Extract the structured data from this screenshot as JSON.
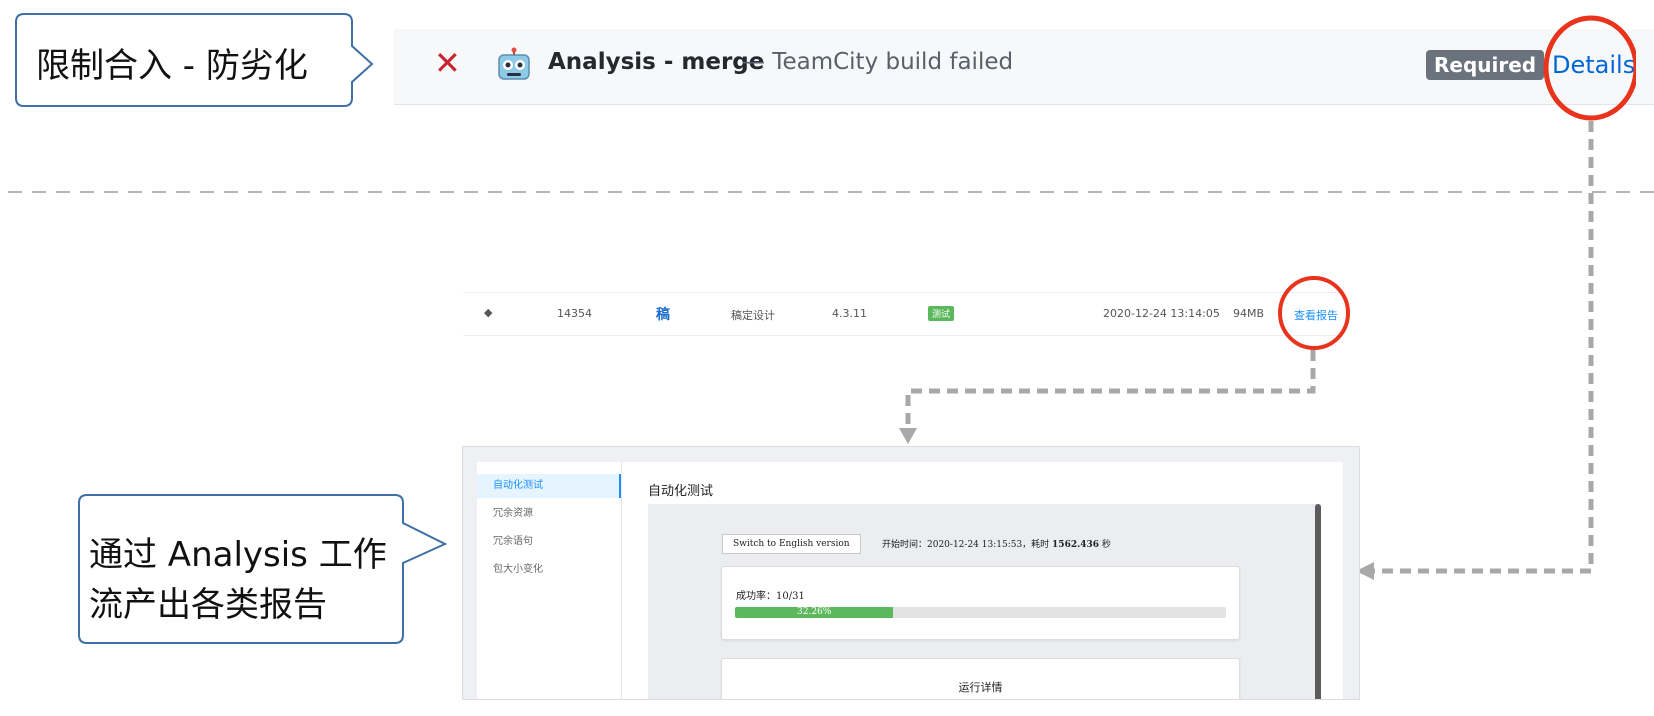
{
  "check": {
    "status_glyph": "✕",
    "name": "Analysis - merge",
    "description": "— TeamCity build failed",
    "required_badge": "Required",
    "details_link": "Details"
  },
  "callouts": {
    "top": "限制合入 - 防劣化",
    "bottom_line1": "通过 Analysis 工作",
    "bottom_line2": "流产出各类报告"
  },
  "list_row": {
    "id": "14354",
    "app_glyph": "稿",
    "name": "稿定设计",
    "version": "4.3.11",
    "tag": "测试",
    "time": "2020-12-24 13:14:05",
    "size": "94MB",
    "report_link": "查看报告"
  },
  "report": {
    "sidebar": [
      "自动化测试",
      "冗余资源",
      "冗余语句",
      "包大小变化"
    ],
    "active_index": 0,
    "title": "自动化测试",
    "lang_button": "Switch to English version",
    "start_prefix": "开始时间：2020-12-24 13:15:53，耗时 ",
    "duration": "1562.436",
    "duration_unit": " 秒",
    "rate_label": "成功率：10/31",
    "rate_percent_text": "32.26%",
    "rate_fraction": 0.3226,
    "run_details": "运行详情"
  },
  "colors": {
    "fail": "#cb2431",
    "link": "#0366d6",
    "highlight_circle": "#e8341c",
    "success": "#5cb85c",
    "callout_border": "#3f6fa6"
  }
}
